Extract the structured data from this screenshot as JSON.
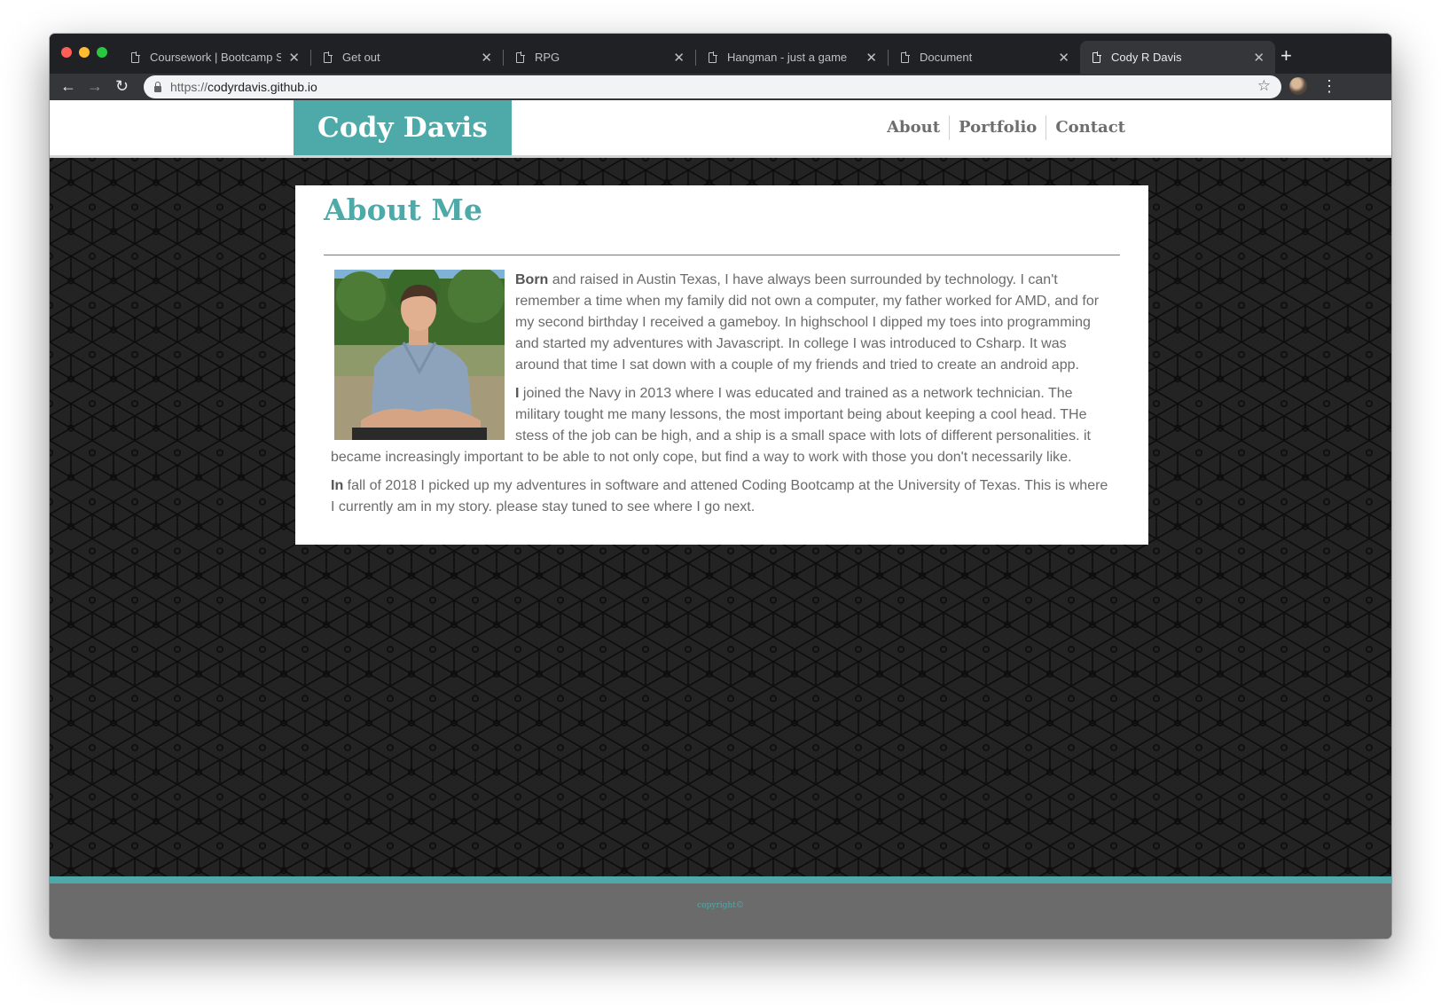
{
  "browser": {
    "tabs": [
      {
        "title": "Coursework | Bootcamp Spot",
        "close": "✕"
      },
      {
        "title": "Get out",
        "close": "✕"
      },
      {
        "title": "RPG",
        "close": "✕"
      },
      {
        "title": "Hangman - just a game",
        "close": "✕"
      },
      {
        "title": "Document",
        "close": "✕"
      },
      {
        "title": "Cody R Davis",
        "close": "✕",
        "active": true
      }
    ],
    "new_tab": "+",
    "back": "←",
    "forward": "→",
    "reload": "↻",
    "url_scheme": "https://",
    "url_host": "codyrdavis.github.io",
    "star": "☆",
    "menu": "⋮"
  },
  "site": {
    "brand": "Cody Davis",
    "nav": [
      "About",
      "Portfolio",
      "Contact"
    ],
    "heading": "About Me",
    "paragraphs": [
      {
        "lead": "Born",
        "text": " and raised in Austin Texas, I have always been surrounded by technology. I can't remember a time when my family did not own a computer, my father worked for AMD, and for my second birthday I received a gameboy. In highschool I dipped my toes into programming and started my adventures with Javascript. In college I was introduced to Csharp. It was around that time I sat down with a couple of my friends and tried to create an android app."
      },
      {
        "lead": "I",
        "text": " joined the Navy in 2013 where I was educated and trained as a network technician. The military tought me many lessons, the most important being about keeping a cool head. THe stess of the job can be high, and a ship is a small space with lots of different personalities. it became increasingly important to be able to not only cope, but find a way to work with those you don't necessarily like."
      },
      {
        "lead": "In",
        "text": " fall of 2018 I picked up my adventures in software and attened Coding Bootcamp at the University of Texas. This is where I currently am in my story. please stay tuned to see where I go next."
      }
    ],
    "copyright": "copyright©"
  },
  "colors": {
    "accent": "#4eaaa8",
    "background": "#232323",
    "footer": "#6b6b6b"
  }
}
